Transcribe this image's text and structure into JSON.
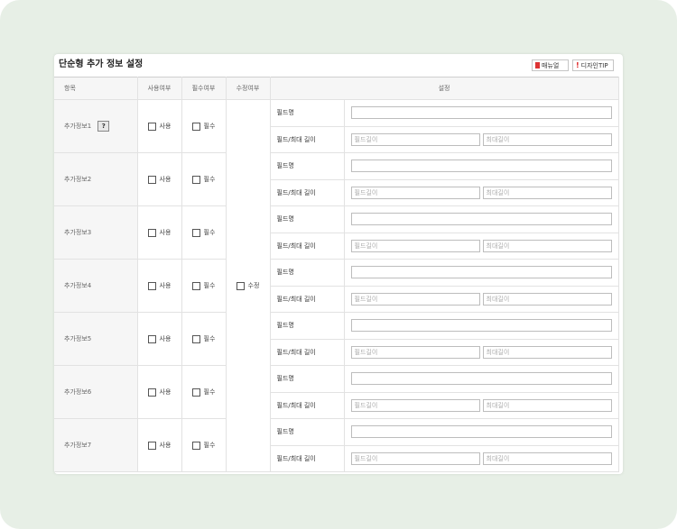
{
  "title": "단순형 추가 정보 설정",
  "toolbar": {
    "manual_label": "매뉴얼",
    "design_tip_label": "디자인TIP"
  },
  "headers": {
    "item": "항목",
    "use": "사용여부",
    "required": "필수여부",
    "edit": "수정여부",
    "settings": "설정"
  },
  "labels": {
    "use": "사용",
    "required": "필수",
    "edit": "수정",
    "field_name": "필드명",
    "field_max_len": "필드/최대 길이",
    "field_len_placeholder": "필드길이",
    "max_len_placeholder": "최대길이",
    "help": "?"
  },
  "rows": [
    {
      "name": "추가정보1"
    },
    {
      "name": "추가정보2"
    },
    {
      "name": "추가정보3"
    },
    {
      "name": "추가정보4"
    },
    {
      "name": "추가정보5"
    },
    {
      "name": "추가정보6"
    },
    {
      "name": "추가정보7"
    }
  ]
}
